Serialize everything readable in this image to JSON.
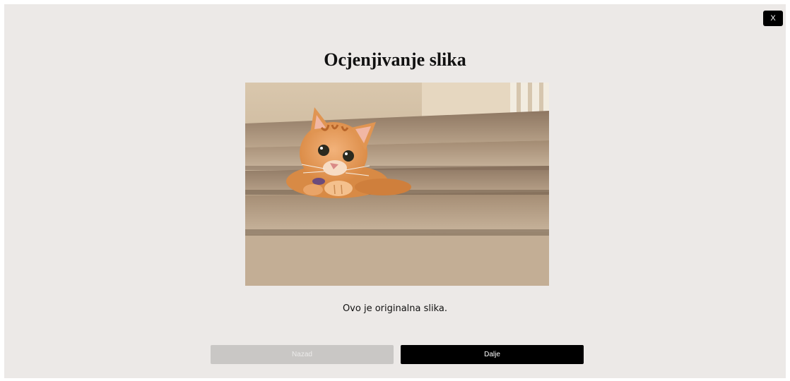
{
  "header": {
    "close_label": "X"
  },
  "main": {
    "title": "Ocjenjivanje slika",
    "image_alt": "kitten-on-stairs",
    "caption": "Ovo je originalna slika."
  },
  "footer": {
    "back_label": "Nazad",
    "next_label": "Dalje"
  },
  "colors": {
    "background": "#ece9e7",
    "primary_button": "#000000",
    "disabled_button": "#c9c7c5"
  }
}
